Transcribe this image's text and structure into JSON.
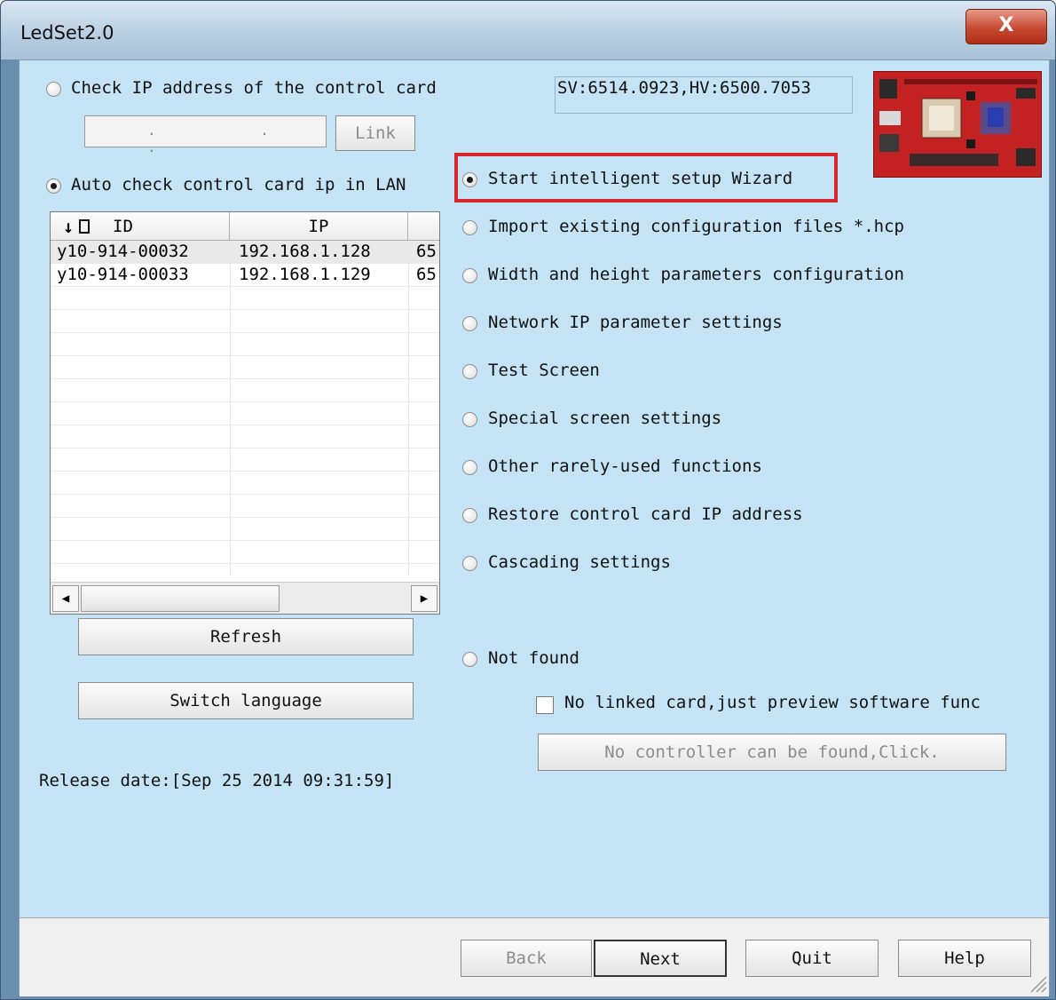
{
  "window": {
    "title": "LedSet2.0",
    "close_label": "X"
  },
  "left": {
    "check_ip_label": "Check IP address of the control card",
    "ip_placeholder": ". . .",
    "link_button": "Link",
    "auto_check_label": "Auto check control card ip in LAN",
    "table": {
      "columns": [
        "ID",
        "IP"
      ],
      "rows": [
        {
          "id": "y10-914-00032",
          "ip": "192.168.1.128",
          "extra": "65"
        },
        {
          "id": "y10-914-00033",
          "ip": "192.168.1.129",
          "extra": "65"
        }
      ]
    },
    "refresh_button": "Refresh",
    "switch_language_button": "Switch language",
    "release_date": "Release date:[Sep 25 2014 09:31:59]"
  },
  "version": "SV:6514.0923,HV:6500.7053",
  "options": [
    "Start intelligent setup Wizard",
    "Import existing configuration files *.hcp",
    "Width and height parameters configuration",
    "Network IP parameter settings",
    "Test Screen",
    "Special screen settings",
    "Other rarely-used functions",
    "Restore control card IP address",
    "Cascading settings"
  ],
  "selected_option": 0,
  "not_found_label": "Not found",
  "no_linked_card_label": "No linked card,just preview software func",
  "no_controller_button": "No controller can be found,Click.",
  "footer": {
    "back": "Back",
    "next": "Next",
    "quit": "Quit",
    "help": "Help"
  },
  "colors": {
    "highlight": "#d8272b",
    "client_bg": "#c4e4f6",
    "board": "#c12424"
  }
}
